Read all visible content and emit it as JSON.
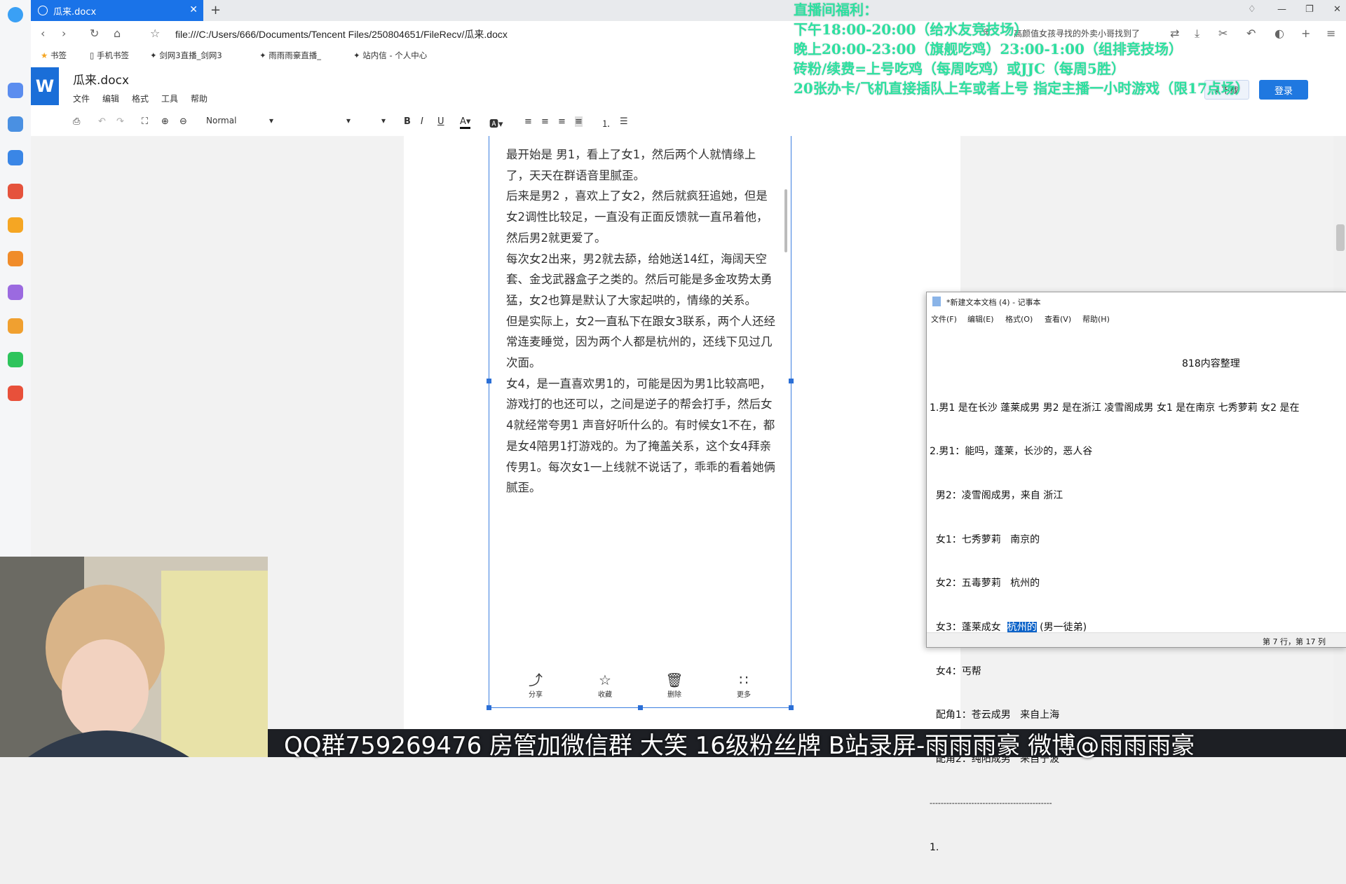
{
  "browser": {
    "tab_title": "瓜来.docx",
    "new_tab": "+",
    "url": "file:///C:/Users/666/Documents/Tencent Files/250804651/FileRecv/瓜来.docx",
    "search_hint": "高颜值女孩寻找的外卖小哥找到了",
    "bookmarks": [
      "书签",
      "手机书签",
      "剑网3直播_剑网3",
      "雨雨雨豪直播_",
      "站内信 - 个人中心"
    ]
  },
  "doc": {
    "name": "瓜来.docx",
    "logo": "W",
    "menus": [
      "文件",
      "编辑",
      "格式",
      "工具",
      "帮助"
    ],
    "download_label": "下载",
    "login_label": "登录",
    "style_select": "Normal",
    "paragraphs": [
      "最开始是 男1，看上了女1，然后两个人就情缘上了，天天在群语音里腻歪。",
      "后来是男2 ，喜欢上了女2，然后就疯狂追她，但是女2调性比较足，一直没有正面反馈就一直吊着他，然后男2就更爱了。",
      "每次女2出来，男2就去舔，给她送14红，海阔天空套、金戈武器盒子之类的。然后可能是多金攻势太勇猛，女2也算是默认了大家起哄的，情缘的关系。",
      "但是实际上，女2一直私下在跟女3联系，两个人还经常连麦睡觉，因为两个人都是杭州的，还线下见过几次面。",
      "女4，是一直喜欢男1的，可能是因为男1比较高吧，游戏打的也还可以，之间是逆子的帮会打手，然后女4就经常夸男1 声音好听什么的。有时候女1不在，都是女4陪男1打游戏的。为了掩盖关系，这个女4拜亲传男1。每次女1一上线就不说话了，乖乖的看着她俩腻歪。"
    ],
    "bottom_actions": [
      "分享",
      "收藏",
      "删除",
      "更多"
    ]
  },
  "promo": {
    "lines": [
      "直播间福利：",
      "下午18:00-20:00（给水友竞技场）",
      "晚上20:00-23:00（旗舰吃鸡）23:00-1:00（组排竞技场）",
      "砖粉/续费=上号吃鸡（每周吃鸡）或JJC（每周5胜）",
      "20张办卡/飞机直接插队上车或者上号 指定主播一小时游戏（限17点场）"
    ]
  },
  "notepad": {
    "title": "*新建文本文档 (4) - 记事本",
    "menus": [
      "文件(F)",
      "编辑(E)",
      "格式(O)",
      "查看(V)",
      "帮助(H)"
    ],
    "heading": "818内容整理",
    "lines": [
      "1.男1 是在长沙 蓬莱成男 男2 是在浙江 凌雪阁成男 女1 是在南京 七秀萝莉 女2 是在",
      "2.男1：能吗，蓬莱，长沙的，恶人谷",
      "  男2：凌雪阁成男，来自 浙江",
      "  女1：七秀萝莉   南京的",
      "  女2：五毒萝莉   杭州的",
      "  女3：蓬莱成女  ",
      "  女4：丐帮",
      "  配角1：苍云成男   来自上海",
      "  配角2：纯阳成男   来自宁波",
      "--------------------------------------------",
      "1."
    ],
    "highlight": "杭州的",
    "highlight_suffix": " (男一徒弟)",
    "status": "第 7 行，第 17 列"
  },
  "banner": {
    "text": "QQ群759269476 房管加微信群 大笑 16级粉丝牌 B站录屏-雨雨雨豪 微博@雨雨雨豪"
  },
  "colors": {
    "accent": "#1a73e8",
    "promo": "#2de0a0",
    "highlight": "#0b62c8"
  }
}
